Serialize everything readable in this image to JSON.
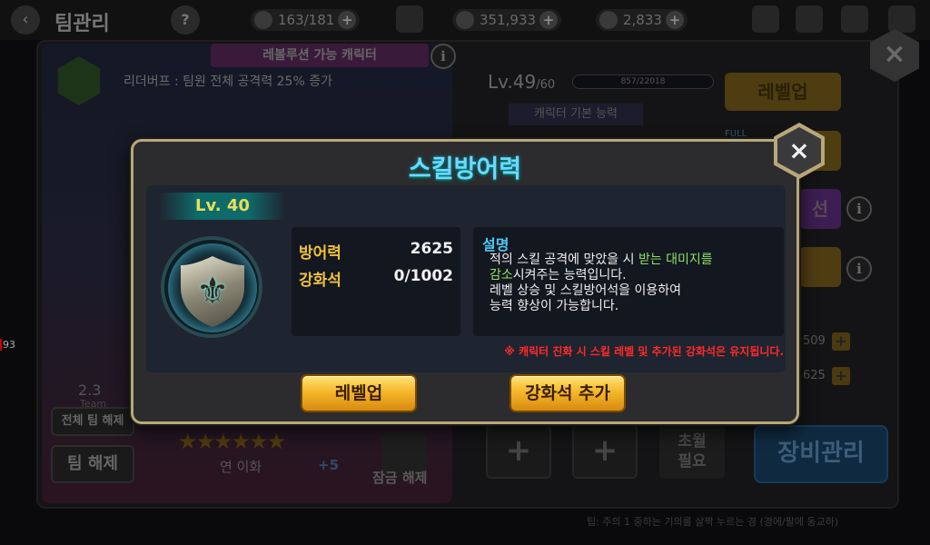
{
  "topbar": {
    "title": "팀관리",
    "help": "?",
    "stamina": "163/181",
    "gold": "351,933",
    "gems": "2,833",
    "back": "‹",
    "plus": "+"
  },
  "background": {
    "evolution_banner": "레볼루션 가능 캐릭터",
    "leader_buff": "리더버프 : 팀원 전체 공격력 25% 증가",
    "level": "Lv.49",
    "level_max": "/60",
    "exp": "857/22018",
    "basic_ability": "캐릭터 기본 능력",
    "levelup_button": "레벨업",
    "full_tag": "FULL",
    "evolution_btn_partial": "선",
    "stat_a": "509",
    "stat_b": "625",
    "team_num": "2.3",
    "team_label": "Team",
    "team_release_all": "전체 팀 해제",
    "team_release": "팀 해제",
    "partner_text": "연 이화",
    "plus_five": "+5",
    "lock_release": "잠금 해제",
    "transcend_required": "초월\n필요",
    "equip_manage": "장비관리",
    "bottom_note": "팁: 주의 1 중하는 기의를 살짝 누르는 경 (경에/팔에 동교하)",
    "left_number": "93",
    "info": "i",
    "slot_plus": "+"
  },
  "modal": {
    "title": "스킬방어력",
    "level_badge": "Lv. 40",
    "stats": [
      {
        "label": "방어력",
        "value": "2625"
      },
      {
        "label": "강화석",
        "value": "0/1002"
      }
    ],
    "desc_title": "설명",
    "desc_line1_a": "적의 스킬 공격에 맞았을 시 ",
    "desc_line1_b": "받는 대미지를",
    "desc_line2_a": "감소",
    "desc_line2_b": "시켜주는 능력입니다.",
    "desc_line3": "레벨 상승 및 스킬방어석을 이용하여",
    "desc_line4": "능력 향상이 가능합니다.",
    "notice": "※ 캐릭터 진화 시 스킬 레벨 및 추가된 강화석은 유지됩니다.",
    "levelup_button": "레벨업",
    "add_stone_button": "강화석 추가",
    "close": "×",
    "skill_symbol": "⚜"
  },
  "colors": {
    "title_cyan": "#6fd8ff",
    "stat_label_gold": "#f0c23a",
    "desc_highlight_green": "#8ee06a",
    "notice_red": "#ff2a2a",
    "button_gold": "#f6b82a",
    "modal_border": "#b8a779"
  }
}
